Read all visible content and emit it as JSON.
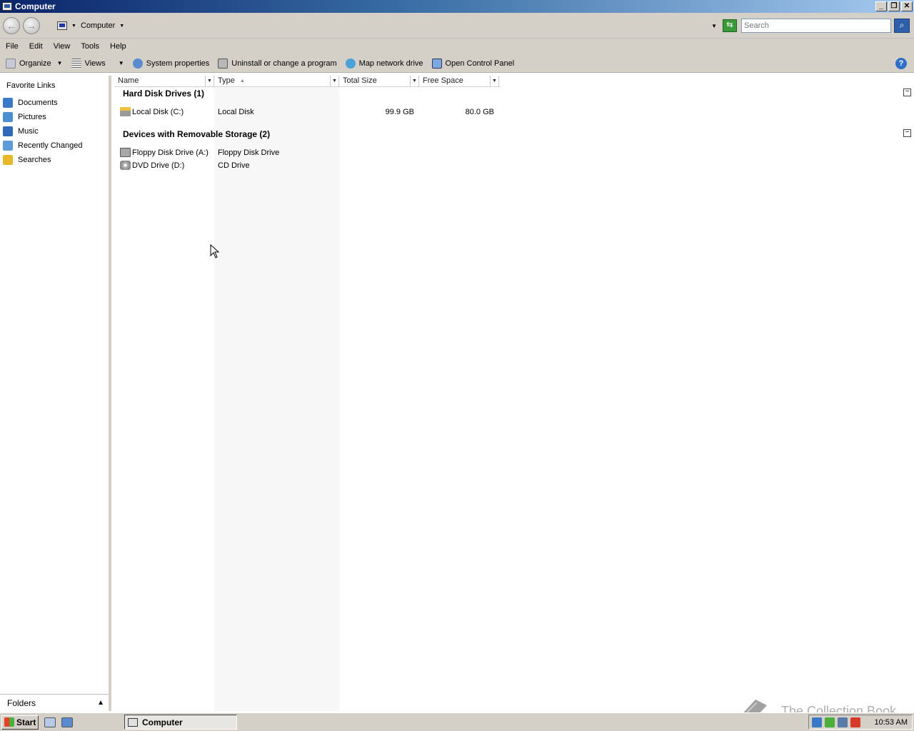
{
  "window": {
    "title": "Computer",
    "controls": [
      "_",
      "❐",
      "✕"
    ]
  },
  "address": {
    "location": "Computer",
    "search_placeholder": "Search"
  },
  "menu": [
    "File",
    "Edit",
    "View",
    "Tools",
    "Help"
  ],
  "toolbar": {
    "organize": "Organize",
    "views": "Views",
    "system_properties": "System properties",
    "uninstall": "Uninstall or change a program",
    "map_drive": "Map network drive",
    "control_panel": "Open Control Panel",
    "help": "?"
  },
  "sidebar": {
    "title": "Favorite Links",
    "items": [
      {
        "label": "Documents",
        "icon": "documents-icon",
        "color": "#3a78c8"
      },
      {
        "label": "Pictures",
        "icon": "pictures-icon",
        "color": "#4b8fd0"
      },
      {
        "label": "Music",
        "icon": "music-icon",
        "color": "#2f6ab8"
      },
      {
        "label": "Recently Changed",
        "icon": "recent-icon",
        "color": "#5c9ad8"
      },
      {
        "label": "Searches",
        "icon": "searches-folder-icon",
        "color": "#e8b828"
      }
    ],
    "folders_label": "Folders"
  },
  "columns": [
    "Name",
    "Type",
    "Total Size",
    "Free Space"
  ],
  "groups": [
    {
      "title": "Hard Disk Drives (1)",
      "rows": [
        {
          "name": "Local Disk (C:)",
          "type": "Local Disk",
          "total": "99.9 GB",
          "free": "80.0 GB"
        }
      ]
    },
    {
      "title": "Devices with Removable Storage (2)",
      "rows": [
        {
          "name": "Floppy Disk Drive (A:)",
          "type": "Floppy Disk Drive",
          "total": "",
          "free": ""
        },
        {
          "name": "DVD Drive (D:)",
          "type": "CD Drive",
          "total": "",
          "free": ""
        }
      ]
    }
  ],
  "taskbar": {
    "start": "Start",
    "task": "Computer",
    "clock": "10:53 AM"
  },
  "watermark": "The Collection Book"
}
